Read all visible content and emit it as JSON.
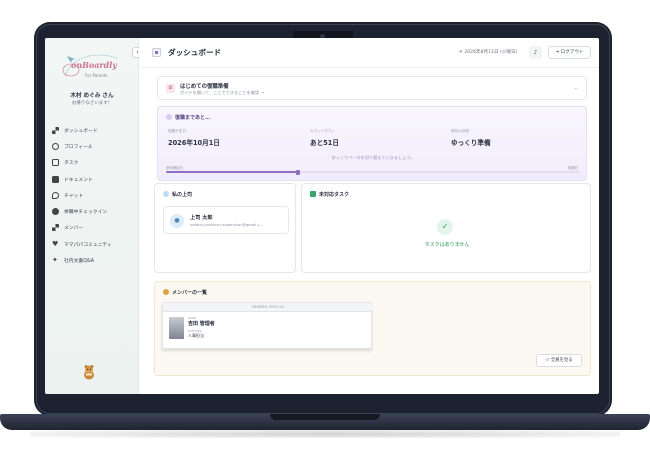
{
  "sidebar": {
    "collapse_glyph": "‹",
    "logo_text": "onBoardly",
    "logo_sub": "For Parents",
    "user_name": "木村 めぐみ さん",
    "greeting": "お帰りなさいます！",
    "items": [
      {
        "label": "ダッシュボード",
        "icon": "grid-icon"
      },
      {
        "label": "プロフィール",
        "icon": "user-circle-icon"
      },
      {
        "label": "タスク",
        "icon": "clipboard-icon"
      },
      {
        "label": "ドキュメント",
        "icon": "document-icon"
      },
      {
        "label": "チャット",
        "icon": "chat-icon"
      },
      {
        "label": "休職中チェックイン",
        "icon": "checkin-icon"
      },
      {
        "label": "メンバー",
        "icon": "members-icon"
      },
      {
        "label": "ママパパコミュニティ",
        "icon": "heart-icon"
      },
      {
        "label": "社内文書Q&A",
        "icon": "sparkle-icon"
      }
    ]
  },
  "header": {
    "title": "ダッシュボード",
    "date": "2026年8月11日 (火曜日)",
    "logout": "ログアウト"
  },
  "guide": {
    "title": "はじめての復職準備",
    "subtitle": "ガイドを開いて、ここでできることを確認 →"
  },
  "return_plan": {
    "title": "復職まであと…",
    "columns": [
      {
        "label": "復職予定日",
        "value": "2026年10月1日"
      },
      {
        "label": "カウントダウン",
        "value": "あと51日"
      },
      {
        "label": "現在の状態",
        "value": "ゆっくり準備"
      }
    ],
    "message": "ゆっくりペースを切り替えていきましょう。",
    "bar_left": "産休開始日",
    "bar_right": "復職日",
    "progress": 0.32
  },
  "boss": {
    "title": "私の上司",
    "name": "上司 太郎",
    "email": "kotomi.yoshida+supervisor@gmail.c..."
  },
  "tasks": {
    "title": "未対応タスク",
    "empty": "タスクはありません"
  },
  "members": {
    "title": "メンバーの一覧",
    "card_header": "MEMBER PROFILE",
    "name_label": "NAME",
    "name": "吉田 管理者",
    "position_label": "POSITION",
    "position": "人事担当",
    "view_all": "全員を見る"
  },
  "colors": {
    "accent_purple": "#8d6fc4",
    "success_green": "#2e9b5c",
    "pink": "#c9748d"
  }
}
